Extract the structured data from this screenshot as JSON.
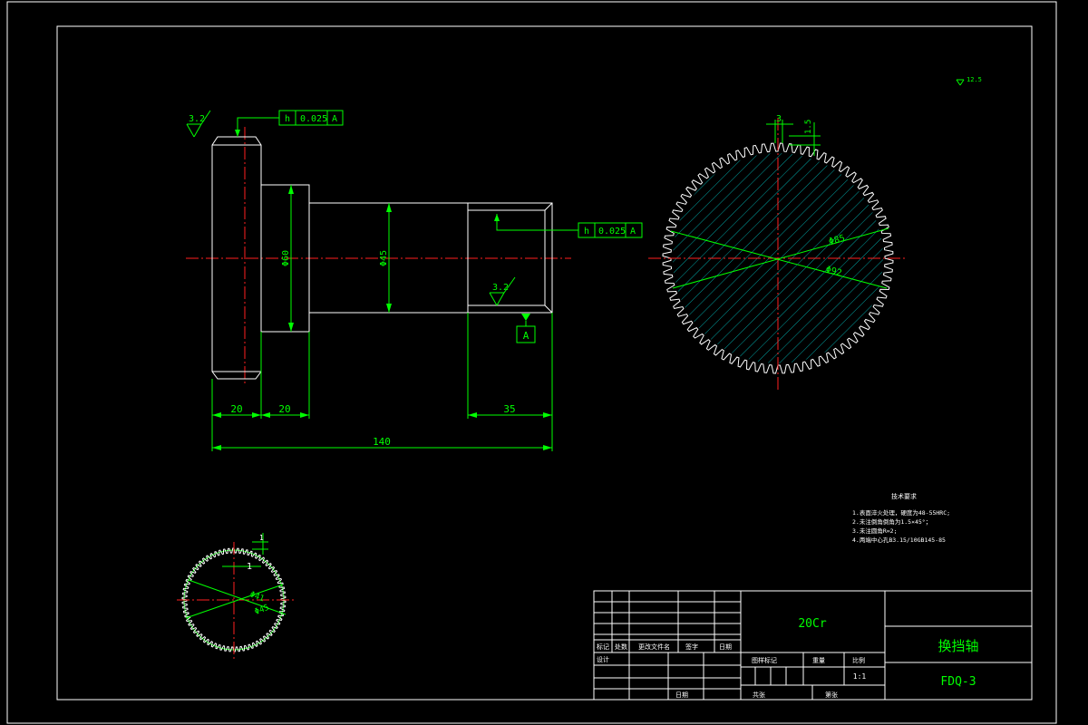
{
  "drawing": {
    "roughness_top": "3.2",
    "roughness_bottom": "3.2",
    "tolerance_top": {
      "symbol": "h",
      "value": "0.025",
      "datum": "A"
    },
    "tolerance_mid": {
      "symbol": "h",
      "value": "0.025",
      "datum": "A"
    },
    "datum_label": "A",
    "dim_dia_60": "Φ60",
    "dim_dia_45": "Φ45",
    "dim_20a": "20",
    "dim_20b": "20",
    "dim_35": "35",
    "dim_140": "140",
    "gear_dim_3": "3",
    "gear_dim_15": "1.5",
    "gear_dia_85": "Φ85",
    "gear_dia_92": "Φ92",
    "spline_dim_1": "1",
    "spline_dim_1b": "1",
    "spline_dia_41": "Φ41",
    "spline_dia_45": "Φ45",
    "other_roughness": "12.5"
  },
  "notes": {
    "title": "技术要求",
    "lines": [
      "1.表面淬火处理，硬度为48-55HRC;",
      "2.未注倒角倒角为1.5×45°；",
      "3.未注圆角R=2;",
      "4.两端中心孔B3.15/10GB145-85"
    ]
  },
  "title_block": {
    "material": "20Cr",
    "part_name": "换挡轴",
    "drawing_no": "FDQ-3",
    "scale": "1:1",
    "labels": {
      "mark": "标记",
      "count": "处数",
      "change_doc": "更改文件名",
      "sign": "签字",
      "date": "日期",
      "design": "设计",
      "stage_mark": "图样标记",
      "weight": "重量",
      "ratio": "比例",
      "sheet_total": "共张",
      "sheet_no": "第张",
      "approve_date": "日期"
    }
  }
}
